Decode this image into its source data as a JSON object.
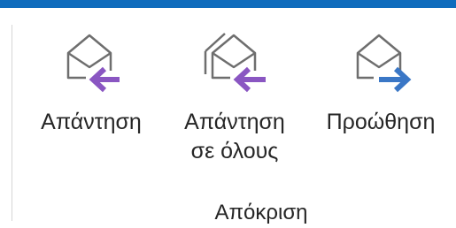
{
  "ribbon": {
    "accent_color": "#0f6cbd",
    "group_label": "Απόκριση",
    "buttons": [
      {
        "id": "reply",
        "label": "Απάντηση",
        "label_line2": "",
        "icon": "reply-envelope-icon",
        "arrow_color": "#8a56c2"
      },
      {
        "id": "reply-all",
        "label": "Απάντηση",
        "label_line2": "σε όλους",
        "icon": "reply-all-envelope-icon",
        "arrow_color": "#8a56c2"
      },
      {
        "id": "forward",
        "label": "Προώθηση",
        "label_line2": "",
        "icon": "forward-envelope-icon",
        "arrow_color": "#3a77c6"
      }
    ]
  }
}
